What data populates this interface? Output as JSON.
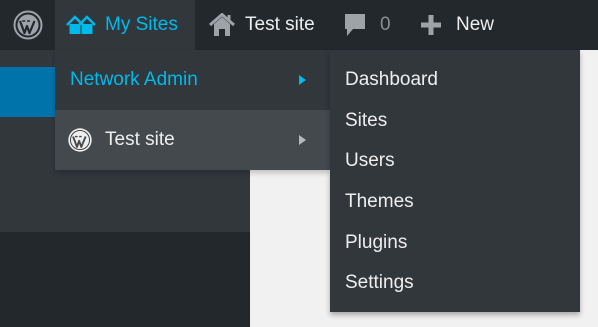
{
  "adminbar": {
    "logo_icon": "wordpress-logo-icon",
    "my_sites": {
      "label": "My Sites",
      "icon": "my-sites-icon"
    },
    "test_site": {
      "label": "Test site",
      "icon": "home-icon"
    },
    "comments": {
      "count": "0",
      "icon": "comment-icon"
    },
    "new": {
      "label": "New",
      "icon": "plus-icon"
    }
  },
  "my_sites_menu": {
    "items": [
      {
        "label": "Network Admin"
      },
      {
        "label": "Test site",
        "icon": "wordpress-logo-icon"
      }
    ]
  },
  "network_admin_submenu": {
    "items": [
      {
        "label": "Dashboard"
      },
      {
        "label": "Sites"
      },
      {
        "label": "Users"
      },
      {
        "label": "Themes"
      },
      {
        "label": "Plugins"
      },
      {
        "label": "Settings"
      }
    ]
  },
  "colors": {
    "adminbar_bg": "#23282d",
    "menu_bg": "#32373c",
    "hover_bg": "#44494e",
    "accent": "#00b9eb",
    "sidebar_active": "#0073aa",
    "content_bg": "#f1f1f1"
  }
}
